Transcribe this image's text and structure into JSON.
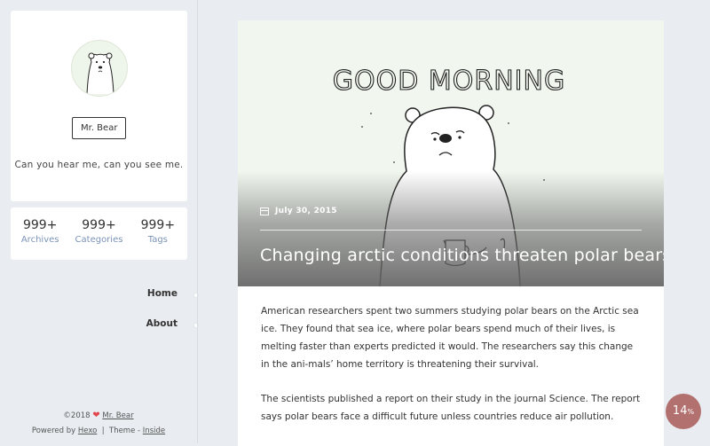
{
  "profile": {
    "name": "Mr. Bear",
    "tagline": "Can you hear me, can you see me."
  },
  "stats": [
    {
      "value": "999+",
      "label": "Archives"
    },
    {
      "value": "999+",
      "label": "Categories"
    },
    {
      "value": "999+",
      "label": "Tags"
    }
  ],
  "nav": {
    "home": "Home",
    "about": "About"
  },
  "footer": {
    "year": "©2018",
    "heart_icon": "heart-icon",
    "author": "Mr. Bear",
    "powered_by": "Powered by",
    "hexo": "Hexo",
    "separator": "|",
    "theme_label": "Theme -",
    "theme": "Inside"
  },
  "post": {
    "hero_caption": "GOOD MORNING",
    "date": "July 30, 2015",
    "title": "Changing arctic conditions threaten polar bears",
    "paragraphs": [
      "American researchers spent two summers studying polar bears on the Arctic sea ice. They found that sea ice, where polar bears spend much of their lives, is melting faster than experts predicted it would. The researchers say this change in the ani-mals’ home territory is threatening their survival.",
      "The scientists published a report on their study in the journal Science. The report says polar bears face a difficult future unless countries reduce air pollution."
    ]
  },
  "progress": {
    "value": "14",
    "unit": "%",
    "fraction": 0.14
  },
  "colors": {
    "page_bg": "#e9edf1",
    "accent_label": "#7b93b6",
    "progress_bg": "#b2706f",
    "heart": "#e2454b"
  }
}
